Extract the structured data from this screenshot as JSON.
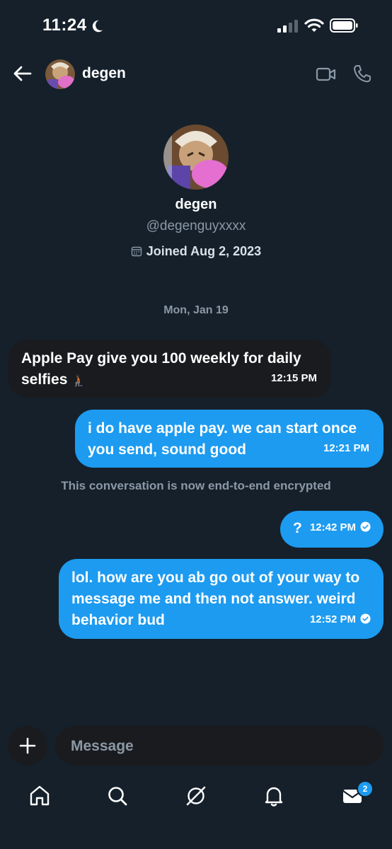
{
  "status_bar": {
    "time": "11:24"
  },
  "header": {
    "name": "degen"
  },
  "profile": {
    "name": "degen",
    "handle": "@degenguyxxxx",
    "joined": "Joined Aug 2, 2023"
  },
  "conversation": {
    "date_separator": "Mon, Jan 19",
    "encryption_notice": "This conversation is now end-to-end encrypted",
    "messages": [
      {
        "direction": "incoming",
        "text": "Apple Pay give you 100 weekly for daily selfies",
        "emoji": "🧎🏿",
        "time": "12:15 PM"
      },
      {
        "direction": "outgoing",
        "text": "i do have apple pay. we can start once you send, sound good",
        "time": "12:21 PM"
      },
      {
        "direction": "outgoing",
        "text": "?",
        "time": "12:42 PM",
        "read": true
      },
      {
        "direction": "outgoing",
        "text": "lol. how are you ab go out of your way to message me and then not answer. weird behavior bud",
        "time": "12:52 PM",
        "read": true
      }
    ]
  },
  "composer": {
    "placeholder": "Message"
  },
  "nav": {
    "items": [
      "home-icon",
      "search-icon",
      "grok-icon",
      "bell-icon",
      "mail-icon"
    ],
    "mail_badge": "2"
  },
  "colors": {
    "background": "#15202b",
    "accent": "#1d9bf0",
    "incoming_bubble": "#1a1b1f",
    "muted": "#8b98a5"
  }
}
